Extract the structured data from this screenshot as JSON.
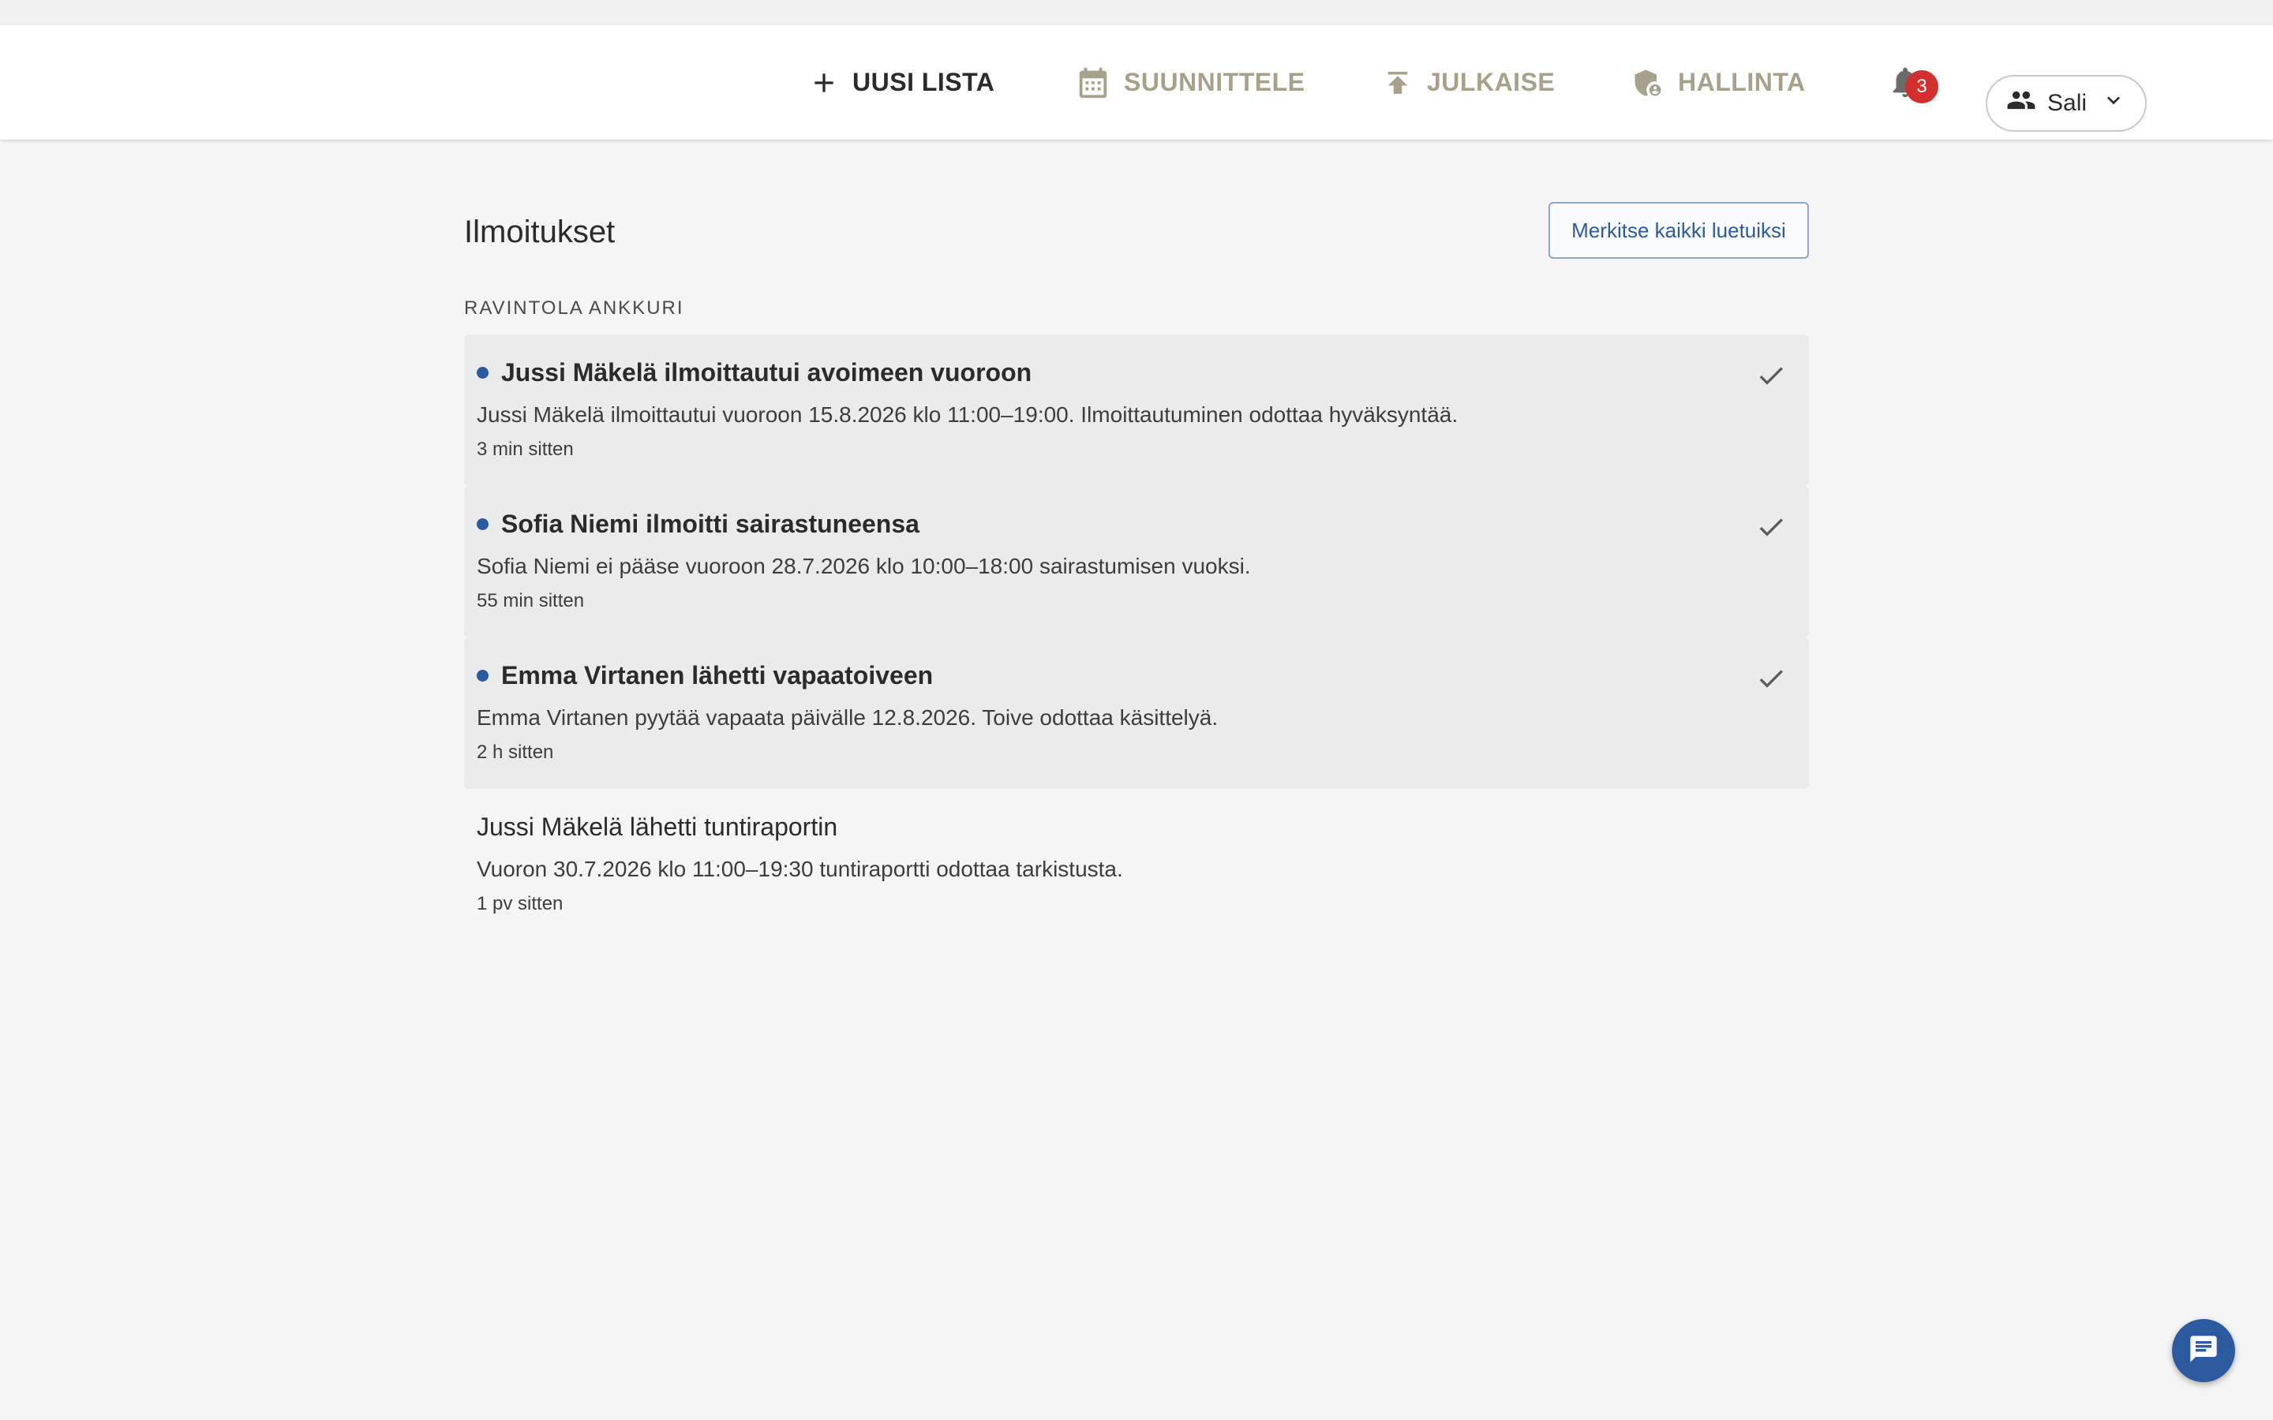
{
  "nav": {
    "new_list": "UUSI LISTA",
    "plan": "SUUNNITTELE",
    "publish": "JULKAISE",
    "admin": "HALLINTA"
  },
  "notifications_badge": "3",
  "user": {
    "name": "Sali"
  },
  "page": {
    "title": "Ilmoitukset",
    "mark_all_read": "Merkitse kaikki luetuiksi",
    "section": "RAVINTOLA ANKKURI"
  },
  "notifications": [
    {
      "title": "Jussi Mäkelä ilmoittautui avoimeen vuoroon",
      "body": "Jussi Mäkelä ilmoittautui vuoroon 15.8.2026 klo 11:00–19:00. Ilmoittautuminen odottaa hyväksyntää.",
      "time": "3 min sitten",
      "unread": true
    },
    {
      "title": "Sofia Niemi ilmoitti sairastuneensa",
      "body": "Sofia Niemi ei pääse vuoroon 28.7.2026 klo 10:00–18:00 sairastumisen vuoksi.",
      "time": "55 min sitten",
      "unread": true
    },
    {
      "title": "Emma Virtanen lähetti vapaatoiveen",
      "body": "Emma Virtanen pyytää vapaata päivälle 12.8.2026. Toive odottaa käsittelyä.",
      "time": "2 h sitten",
      "unread": true
    },
    {
      "title": "Jussi Mäkelä lähetti tuntiraportin",
      "body": "Vuoron 30.7.2026 klo 11:00–19:30 tuntiraportti odottaa tarkistusta.",
      "time": "1 pv sitten",
      "unread": false
    }
  ],
  "colors": {
    "accent": "#2c5aa0",
    "nav_inactive": "#a7a18c",
    "badge": "#d32f2f",
    "unread_bg": "#ebebeb"
  },
  "icons": {
    "new_list": "plus-icon",
    "plan": "calendar-icon",
    "publish": "upload-icon",
    "admin": "admin-shield-icon",
    "notifications": "bell-icon",
    "user": "group-icon",
    "user_menu": "chevron-down-icon",
    "mark_read": "check-icon",
    "chat": "chat-icon"
  }
}
